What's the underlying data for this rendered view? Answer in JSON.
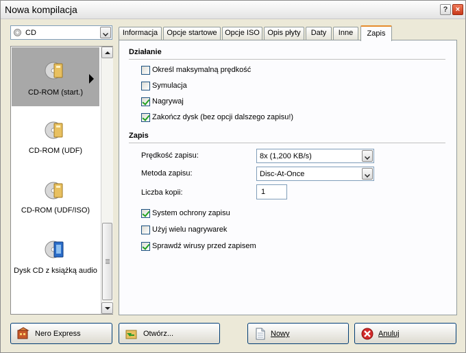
{
  "window": {
    "title": "Nowa kompilacja"
  },
  "title_buttons": {
    "help": "?",
    "close": "×"
  },
  "disc_type": {
    "value": "CD"
  },
  "compilations": [
    {
      "label": "CD-ROM (start.)",
      "selected": true,
      "icon": "cd-rom-boot-icon"
    },
    {
      "label": "CD-ROM (UDF)",
      "selected": false,
      "icon": "cd-rom-udf-icon"
    },
    {
      "label": "CD-ROM (UDF/ISO)",
      "selected": false,
      "icon": "cd-rom-udf-iso-icon"
    },
    {
      "label": "Dysk CD z książką audio",
      "selected": false,
      "icon": "audio-book-cd-icon"
    }
  ],
  "tabs": [
    {
      "label": "Informacja",
      "active": false
    },
    {
      "label": "Opcje startowe",
      "active": false
    },
    {
      "label": "Opcje ISO",
      "active": false
    },
    {
      "label": "Opis płyty",
      "active": false
    },
    {
      "label": "Daty",
      "active": false
    },
    {
      "label": "Inne",
      "active": false
    },
    {
      "label": "Zapis",
      "active": true
    }
  ],
  "dzialanie": {
    "heading": "Działanie",
    "options": [
      {
        "label": "Określ maksymalną prędkość",
        "checked": false
      },
      {
        "label": "Symulacja",
        "checked": false
      },
      {
        "label": "Nagrywaj",
        "checked": true
      },
      {
        "label": "Zakończ dysk (bez opcji dalszego zapisu!)",
        "checked": true
      }
    ]
  },
  "zapis": {
    "heading": "Zapis",
    "speed_label": "Prędkość zapisu:",
    "speed_value": "8x (1,200 KB/s)",
    "method_label": "Metoda zapisu:",
    "method_value": "Disc-At-Once",
    "copies_label": "Liczba kopii:",
    "copies_value": "1",
    "options": [
      {
        "label": "System ochrony zapisu",
        "checked": true
      },
      {
        "label": "Użyj wielu nagrywarek",
        "checked": false
      },
      {
        "label": "Sprawdź wirusy przed zapisem",
        "checked": true
      }
    ]
  },
  "footer": {
    "nero_express": "Nero Express",
    "open": "Otwórz...",
    "new": "Nowy",
    "cancel": "Anuluj"
  }
}
